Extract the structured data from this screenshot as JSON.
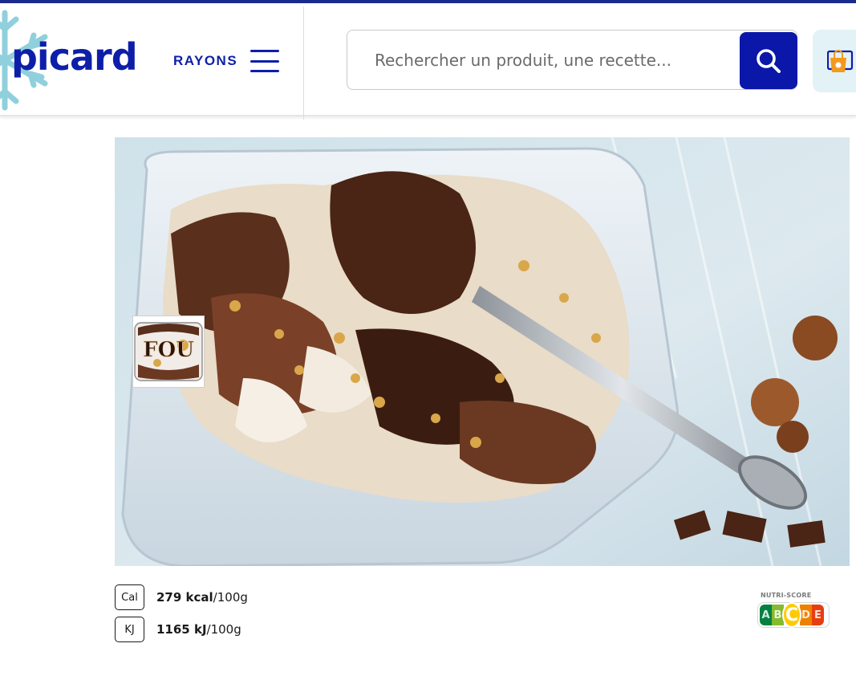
{
  "header": {
    "logo": "picard",
    "rayons_label": "RAYONS",
    "search": {
      "placeholder": "Rechercher un produit, une recette..."
    }
  },
  "product": {
    "thumbnail_text": "FOU"
  },
  "nutrition": {
    "calories": {
      "icon_label": "Cal",
      "value": "279 kcal",
      "unit": "/100g"
    },
    "energy": {
      "icon_label": "KJ",
      "value": "1165 kJ",
      "unit": "/100g"
    }
  },
  "nutriscore": {
    "title": "NUTRI-SCORE",
    "grades": [
      "A",
      "B",
      "C",
      "D",
      "E"
    ],
    "selected": "C",
    "colors": [
      "#038141",
      "#85bb2f",
      "#fecb02",
      "#ee8100",
      "#e63e11"
    ]
  },
  "colors": {
    "brand": "#0d1fa8",
    "search_button": "#0a17a8",
    "cart_bg": "#e3f2f6",
    "top_line": "#1a2a8c"
  }
}
